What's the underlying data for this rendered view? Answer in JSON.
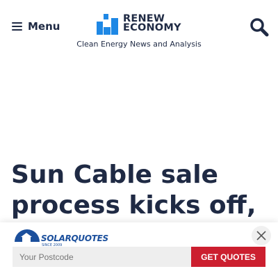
{
  "header": {
    "menu_label": "Menu",
    "logo_line1": "RENEW",
    "logo_line2": "ECONOMY",
    "tagline": "Clean Energy News and Analysis",
    "icons": {
      "menu": "hamburger-icon",
      "search": "search-icon"
    }
  },
  "article": {
    "headline": "Sun Cable sale process kicks off,"
  },
  "quote_widget": {
    "logo_text": "SOLARQUOTES",
    "logo_since": "SINCE 2009",
    "postcode_placeholder": "Your Postcode",
    "button_label": "GET QUOTES",
    "icons": {
      "close": "close-icon",
      "logo": "solarquotes-house-icon"
    }
  },
  "colors": {
    "navy": "#1f2a44",
    "brand_blue": "#1e88e5",
    "quote_button": "#cc1f2f",
    "solarquotes_blue": "#1b4f9c"
  }
}
